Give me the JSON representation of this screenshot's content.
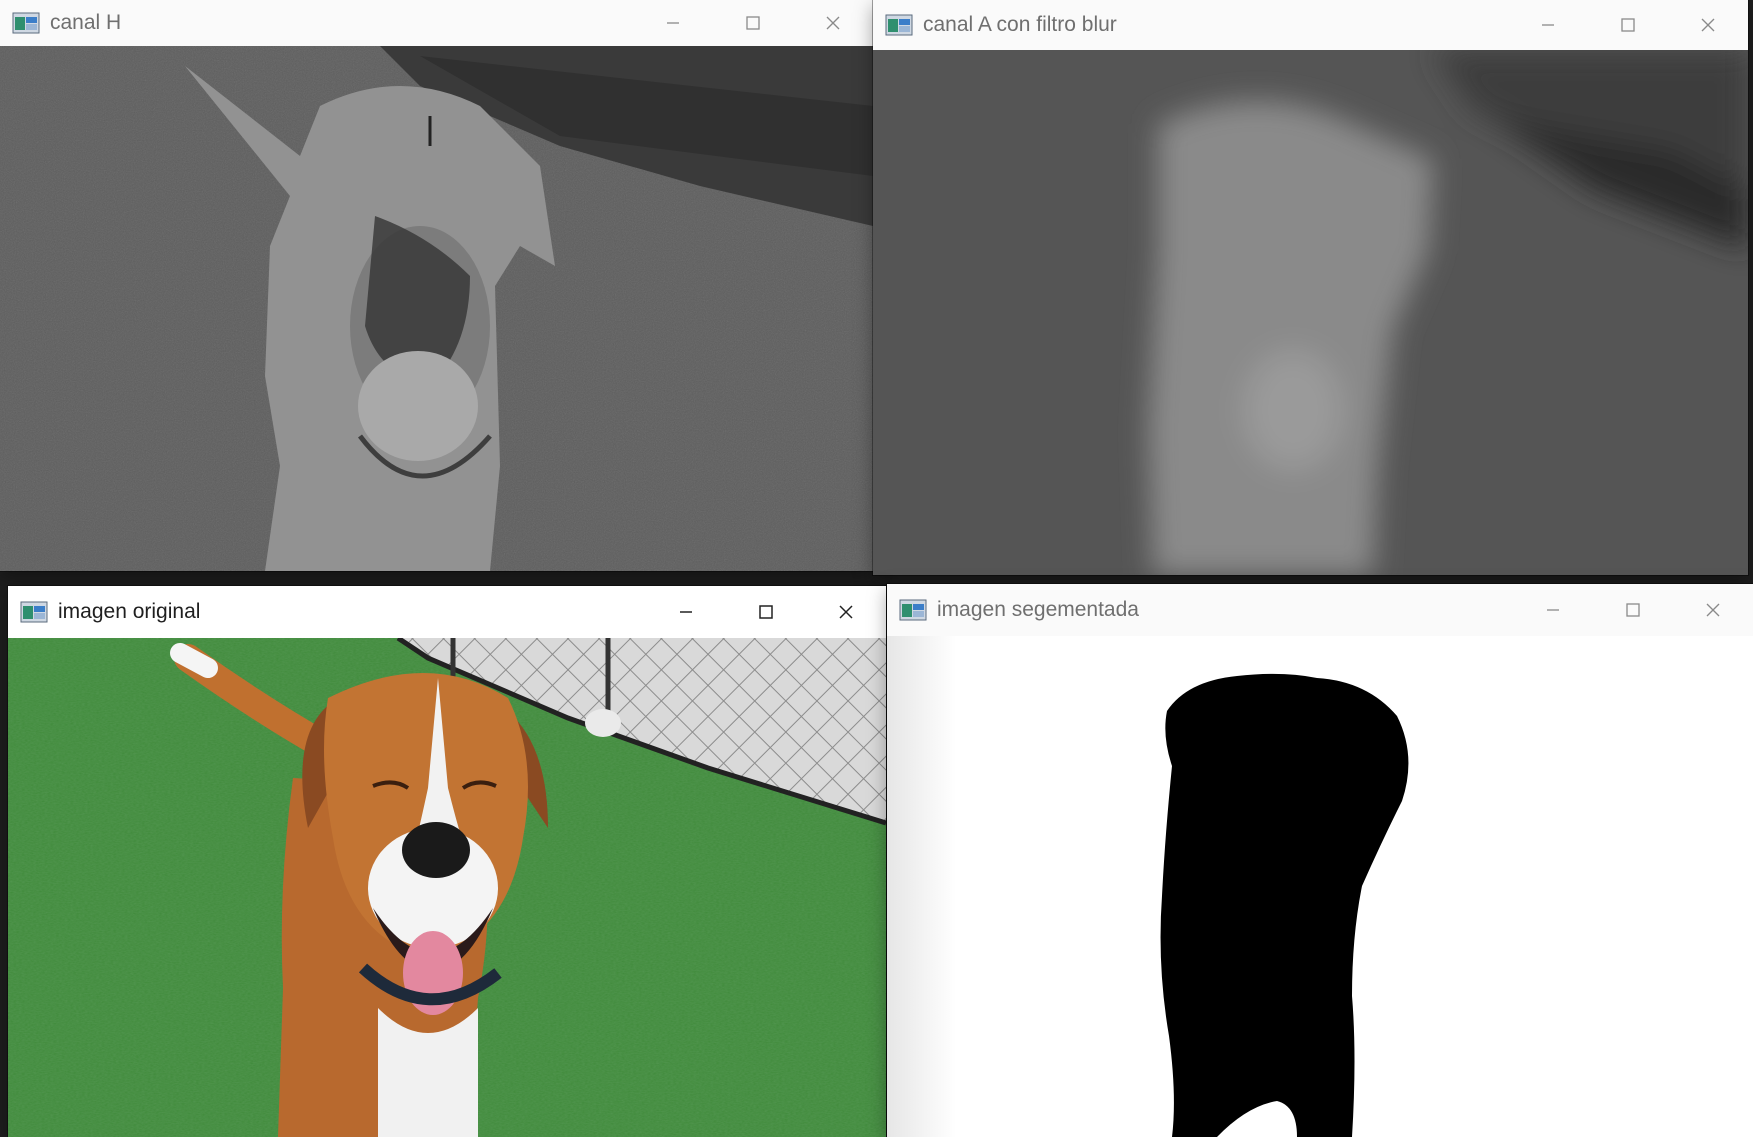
{
  "windows": {
    "canal_h": {
      "title": "canal H"
    },
    "canal_a": {
      "title": "canal A con filtro blur"
    },
    "original": {
      "title": "imagen original"
    },
    "segmentada": {
      "title": "imagen segementada"
    }
  },
  "icons": {
    "app": "app-window-icon",
    "minimize": "minimize-icon",
    "maximize": "maximize-icon",
    "close": "close-icon"
  },
  "colors": {
    "titlebar": "#ffffff",
    "desktop": "#1e1e1e",
    "grass": "#3f8a3a",
    "dog_fur": "#b8692e",
    "mask_black": "#000000",
    "mask_white": "#ffffff"
  }
}
